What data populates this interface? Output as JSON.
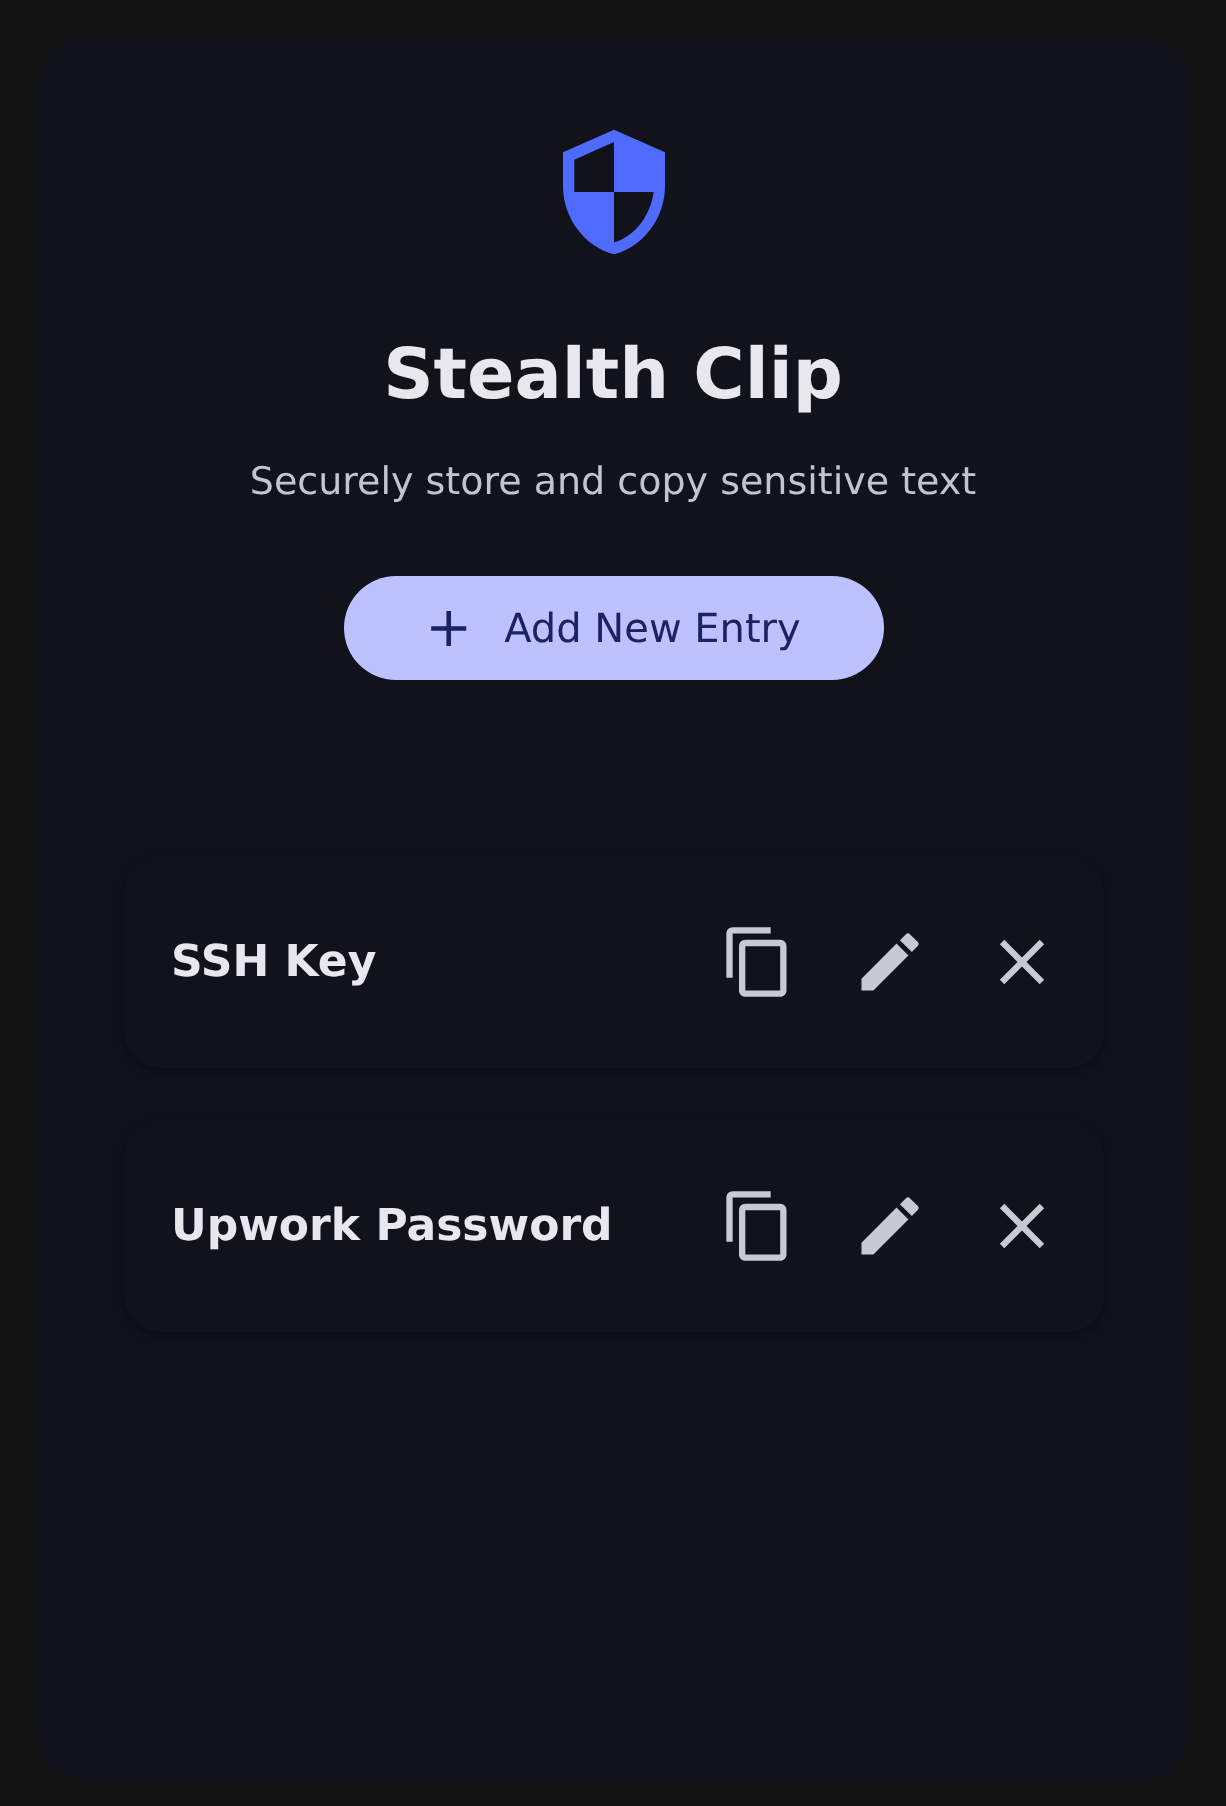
{
  "app": {
    "title": "Stealth Clip",
    "subtitle": "Securely store and copy sensitive text"
  },
  "add_button": {
    "icon": "+",
    "label": "Add New Entry"
  },
  "entries": [
    {
      "name": "SSH Key"
    },
    {
      "name": "Upwork Password"
    }
  ]
}
